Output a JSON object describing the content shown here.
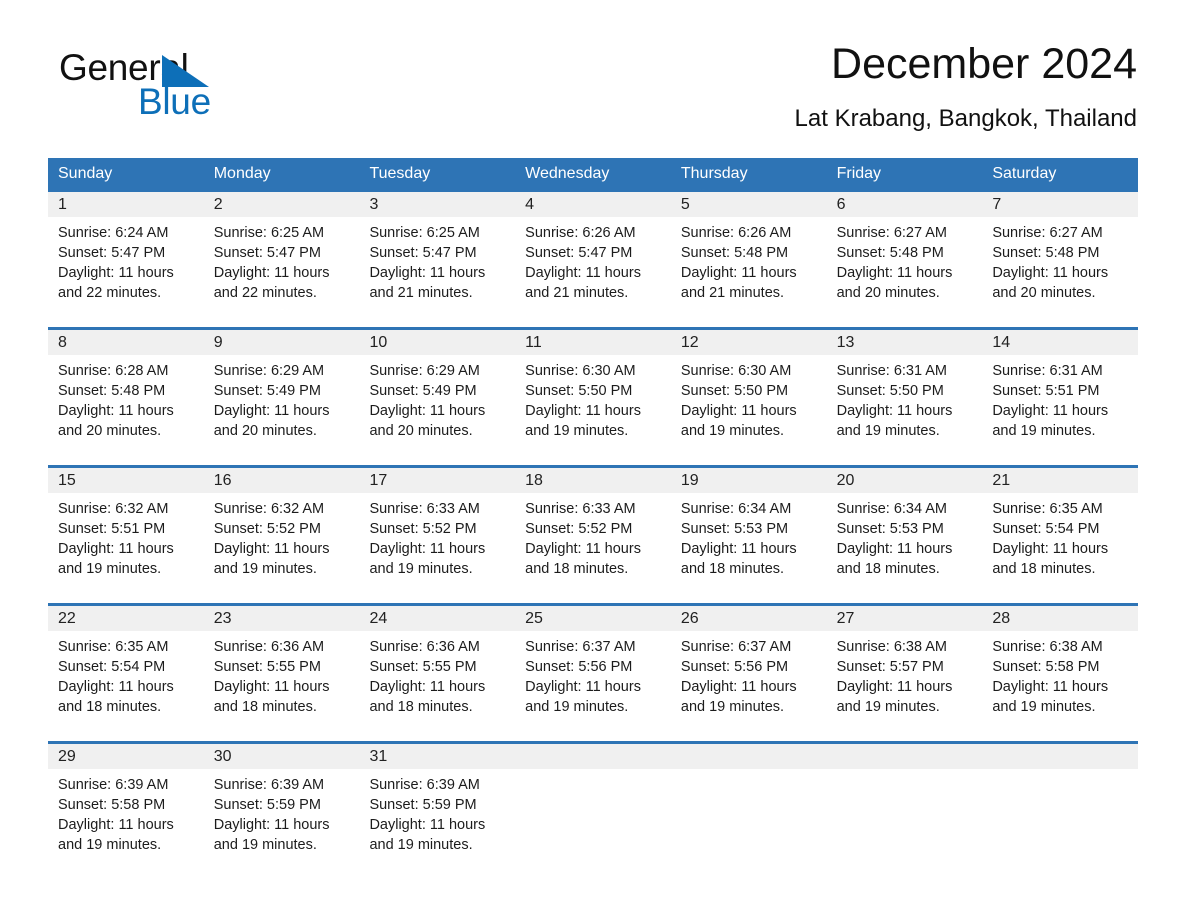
{
  "brand": {
    "name_part1": "General",
    "name_part2": "Blue",
    "accent_color": "#0d6fb8"
  },
  "header": {
    "title": "December 2024",
    "location": "Lat Krabang, Bangkok, Thailand"
  },
  "calendar": {
    "header_bg": "#2e74b5",
    "daynum_bg": "#f0f0f0",
    "weekdays": [
      "Sunday",
      "Monday",
      "Tuesday",
      "Wednesday",
      "Thursday",
      "Friday",
      "Saturday"
    ],
    "weeks": [
      [
        {
          "day": "1",
          "sunrise": "Sunrise: 6:24 AM",
          "sunset": "Sunset: 5:47 PM",
          "daylight_line1": "Daylight: 11 hours",
          "daylight_line2": "and 22 minutes."
        },
        {
          "day": "2",
          "sunrise": "Sunrise: 6:25 AM",
          "sunset": "Sunset: 5:47 PM",
          "daylight_line1": "Daylight: 11 hours",
          "daylight_line2": "and 22 minutes."
        },
        {
          "day": "3",
          "sunrise": "Sunrise: 6:25 AM",
          "sunset": "Sunset: 5:47 PM",
          "daylight_line1": "Daylight: 11 hours",
          "daylight_line2": "and 21 minutes."
        },
        {
          "day": "4",
          "sunrise": "Sunrise: 6:26 AM",
          "sunset": "Sunset: 5:47 PM",
          "daylight_line1": "Daylight: 11 hours",
          "daylight_line2": "and 21 minutes."
        },
        {
          "day": "5",
          "sunrise": "Sunrise: 6:26 AM",
          "sunset": "Sunset: 5:48 PM",
          "daylight_line1": "Daylight: 11 hours",
          "daylight_line2": "and 21 minutes."
        },
        {
          "day": "6",
          "sunrise": "Sunrise: 6:27 AM",
          "sunset": "Sunset: 5:48 PM",
          "daylight_line1": "Daylight: 11 hours",
          "daylight_line2": "and 20 minutes."
        },
        {
          "day": "7",
          "sunrise": "Sunrise: 6:27 AM",
          "sunset": "Sunset: 5:48 PM",
          "daylight_line1": "Daylight: 11 hours",
          "daylight_line2": "and 20 minutes."
        }
      ],
      [
        {
          "day": "8",
          "sunrise": "Sunrise: 6:28 AM",
          "sunset": "Sunset: 5:48 PM",
          "daylight_line1": "Daylight: 11 hours",
          "daylight_line2": "and 20 minutes."
        },
        {
          "day": "9",
          "sunrise": "Sunrise: 6:29 AM",
          "sunset": "Sunset: 5:49 PM",
          "daylight_line1": "Daylight: 11 hours",
          "daylight_line2": "and 20 minutes."
        },
        {
          "day": "10",
          "sunrise": "Sunrise: 6:29 AM",
          "sunset": "Sunset: 5:49 PM",
          "daylight_line1": "Daylight: 11 hours",
          "daylight_line2": "and 20 minutes."
        },
        {
          "day": "11",
          "sunrise": "Sunrise: 6:30 AM",
          "sunset": "Sunset: 5:50 PM",
          "daylight_line1": "Daylight: 11 hours",
          "daylight_line2": "and 19 minutes."
        },
        {
          "day": "12",
          "sunrise": "Sunrise: 6:30 AM",
          "sunset": "Sunset: 5:50 PM",
          "daylight_line1": "Daylight: 11 hours",
          "daylight_line2": "and 19 minutes."
        },
        {
          "day": "13",
          "sunrise": "Sunrise: 6:31 AM",
          "sunset": "Sunset: 5:50 PM",
          "daylight_line1": "Daylight: 11 hours",
          "daylight_line2": "and 19 minutes."
        },
        {
          "day": "14",
          "sunrise": "Sunrise: 6:31 AM",
          "sunset": "Sunset: 5:51 PM",
          "daylight_line1": "Daylight: 11 hours",
          "daylight_line2": "and 19 minutes."
        }
      ],
      [
        {
          "day": "15",
          "sunrise": "Sunrise: 6:32 AM",
          "sunset": "Sunset: 5:51 PM",
          "daylight_line1": "Daylight: 11 hours",
          "daylight_line2": "and 19 minutes."
        },
        {
          "day": "16",
          "sunrise": "Sunrise: 6:32 AM",
          "sunset": "Sunset: 5:52 PM",
          "daylight_line1": "Daylight: 11 hours",
          "daylight_line2": "and 19 minutes."
        },
        {
          "day": "17",
          "sunrise": "Sunrise: 6:33 AM",
          "sunset": "Sunset: 5:52 PM",
          "daylight_line1": "Daylight: 11 hours",
          "daylight_line2": "and 19 minutes."
        },
        {
          "day": "18",
          "sunrise": "Sunrise: 6:33 AM",
          "sunset": "Sunset: 5:52 PM",
          "daylight_line1": "Daylight: 11 hours",
          "daylight_line2": "and 18 minutes."
        },
        {
          "day": "19",
          "sunrise": "Sunrise: 6:34 AM",
          "sunset": "Sunset: 5:53 PM",
          "daylight_line1": "Daylight: 11 hours",
          "daylight_line2": "and 18 minutes."
        },
        {
          "day": "20",
          "sunrise": "Sunrise: 6:34 AM",
          "sunset": "Sunset: 5:53 PM",
          "daylight_line1": "Daylight: 11 hours",
          "daylight_line2": "and 18 minutes."
        },
        {
          "day": "21",
          "sunrise": "Sunrise: 6:35 AM",
          "sunset": "Sunset: 5:54 PM",
          "daylight_line1": "Daylight: 11 hours",
          "daylight_line2": "and 18 minutes."
        }
      ],
      [
        {
          "day": "22",
          "sunrise": "Sunrise: 6:35 AM",
          "sunset": "Sunset: 5:54 PM",
          "daylight_line1": "Daylight: 11 hours",
          "daylight_line2": "and 18 minutes."
        },
        {
          "day": "23",
          "sunrise": "Sunrise: 6:36 AM",
          "sunset": "Sunset: 5:55 PM",
          "daylight_line1": "Daylight: 11 hours",
          "daylight_line2": "and 18 minutes."
        },
        {
          "day": "24",
          "sunrise": "Sunrise: 6:36 AM",
          "sunset": "Sunset: 5:55 PM",
          "daylight_line1": "Daylight: 11 hours",
          "daylight_line2": "and 18 minutes."
        },
        {
          "day": "25",
          "sunrise": "Sunrise: 6:37 AM",
          "sunset": "Sunset: 5:56 PM",
          "daylight_line1": "Daylight: 11 hours",
          "daylight_line2": "and 19 minutes."
        },
        {
          "day": "26",
          "sunrise": "Sunrise: 6:37 AM",
          "sunset": "Sunset: 5:56 PM",
          "daylight_line1": "Daylight: 11 hours",
          "daylight_line2": "and 19 minutes."
        },
        {
          "day": "27",
          "sunrise": "Sunrise: 6:38 AM",
          "sunset": "Sunset: 5:57 PM",
          "daylight_line1": "Daylight: 11 hours",
          "daylight_line2": "and 19 minutes."
        },
        {
          "day": "28",
          "sunrise": "Sunrise: 6:38 AM",
          "sunset": "Sunset: 5:58 PM",
          "daylight_line1": "Daylight: 11 hours",
          "daylight_line2": "and 19 minutes."
        }
      ],
      [
        {
          "day": "29",
          "sunrise": "Sunrise: 6:39 AM",
          "sunset": "Sunset: 5:58 PM",
          "daylight_line1": "Daylight: 11 hours",
          "daylight_line2": "and 19 minutes."
        },
        {
          "day": "30",
          "sunrise": "Sunrise: 6:39 AM",
          "sunset": "Sunset: 5:59 PM",
          "daylight_line1": "Daylight: 11 hours",
          "daylight_line2": "and 19 minutes."
        },
        {
          "day": "31",
          "sunrise": "Sunrise: 6:39 AM",
          "sunset": "Sunset: 5:59 PM",
          "daylight_line1": "Daylight: 11 hours",
          "daylight_line2": "and 19 minutes."
        },
        {
          "day": "",
          "sunrise": "",
          "sunset": "",
          "daylight_line1": "",
          "daylight_line2": ""
        },
        {
          "day": "",
          "sunrise": "",
          "sunset": "",
          "daylight_line1": "",
          "daylight_line2": ""
        },
        {
          "day": "",
          "sunrise": "",
          "sunset": "",
          "daylight_line1": "",
          "daylight_line2": ""
        },
        {
          "day": "",
          "sunrise": "",
          "sunset": "",
          "daylight_line1": "",
          "daylight_line2": ""
        }
      ]
    ]
  }
}
